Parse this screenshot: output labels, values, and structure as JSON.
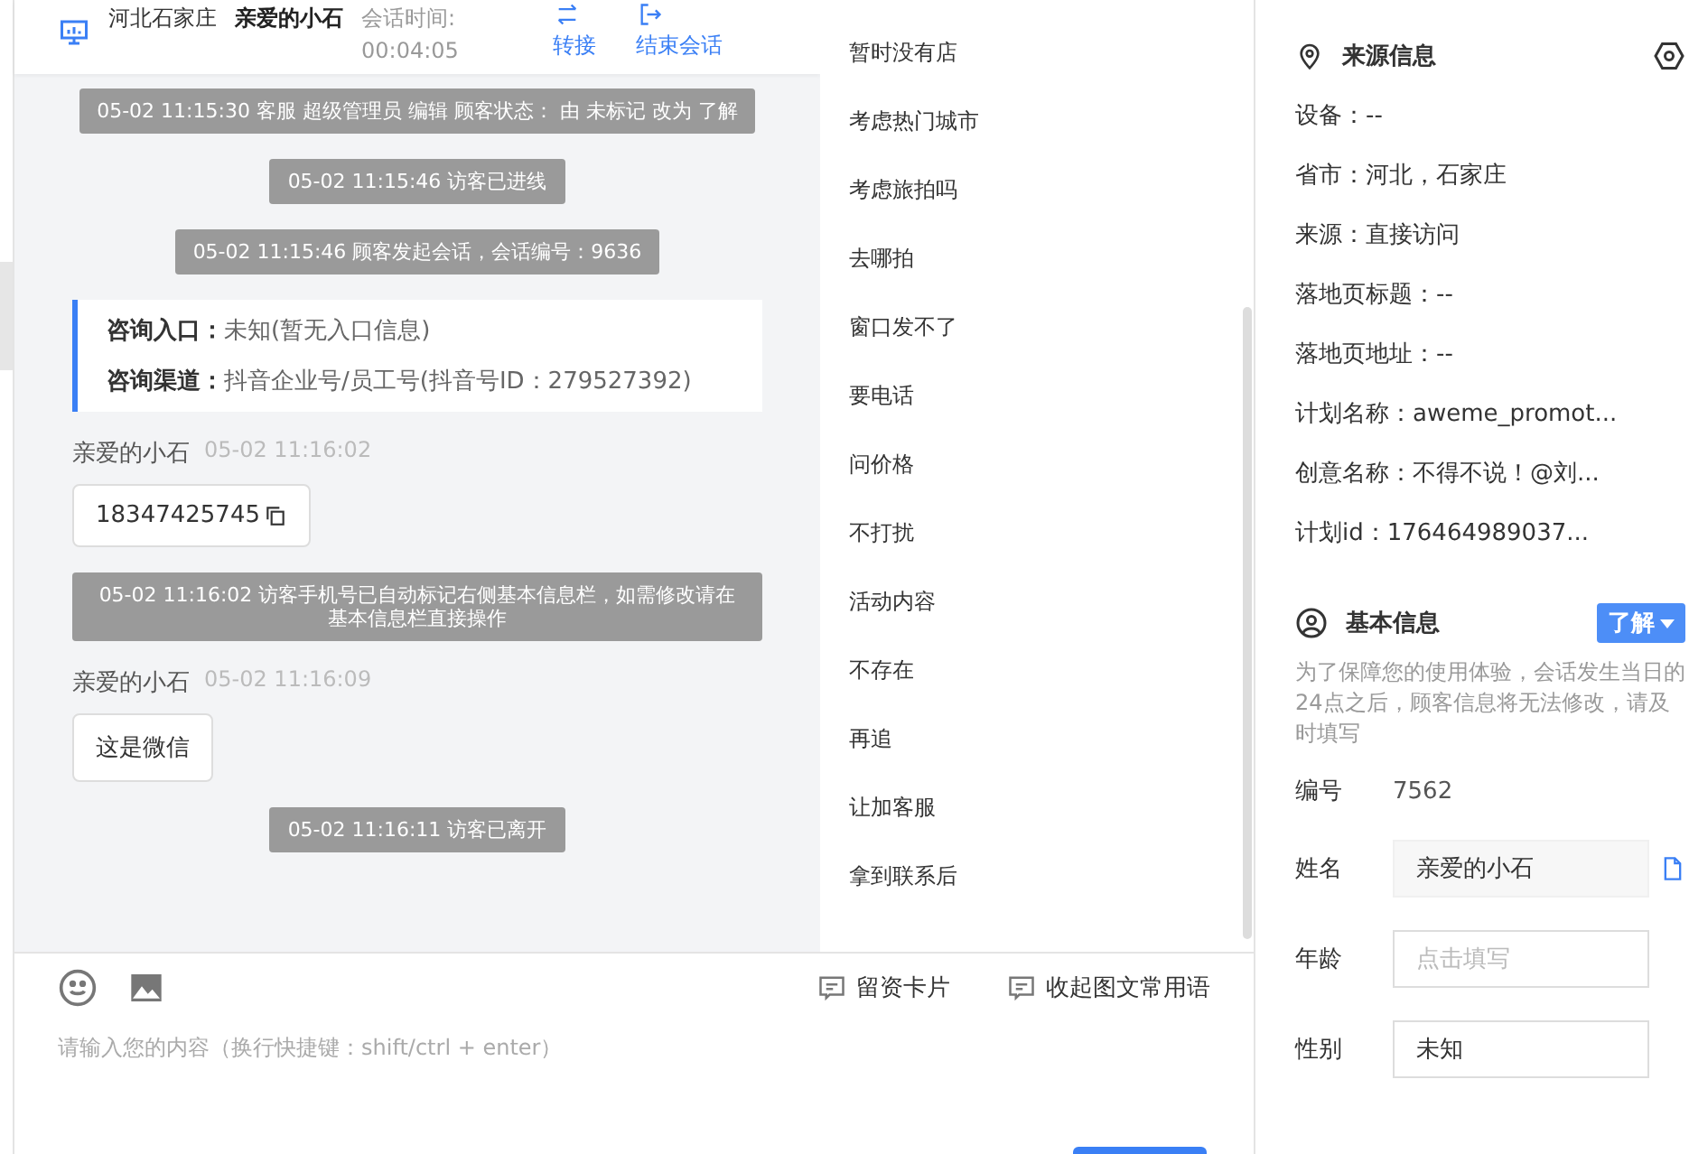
{
  "header": {
    "location": "河北石家庄",
    "visitor_name": "亲爱的小石",
    "session_label": "会话时间:",
    "session_time": "00:04:05",
    "actions": [
      {
        "kind": "transfer",
        "label": "转接"
      },
      {
        "kind": "end",
        "label": "结束会话"
      }
    ]
  },
  "messages": [
    {
      "kind": "system",
      "text": "05-02 11:15:30 客服 超级管理员 编辑 顾客状态： 由 未标记 改为 了解"
    },
    {
      "kind": "system",
      "text": "05-02 11:15:46 访客已进线"
    },
    {
      "kind": "system",
      "text": "05-02 11:15:46 顾客发起会话，会话编号：9636"
    },
    {
      "kind": "info",
      "lines": [
        {
          "label": "咨询入口：",
          "value": "未知(暂无入口信息)"
        },
        {
          "label": "咨询渠道：",
          "value": "抖音企业号/员工号(抖音号ID：279527392)"
        }
      ]
    },
    {
      "kind": "visitor",
      "name": "亲爱的小石",
      "time": "05-02 11:16:02",
      "text": "18347425745",
      "copyable": true
    },
    {
      "kind": "system",
      "text": "05-02 11:16:02 访客手机号已自动标记右侧基本信息栏，如需修改请在基本信息栏直接操作"
    },
    {
      "kind": "visitor",
      "name": "亲爱的小石",
      "time": "05-02 11:16:09",
      "text": "这是微信",
      "copyable": false
    },
    {
      "kind": "system",
      "text": "05-02 11:16:11 访客已离开"
    }
  ],
  "quick_replies": [
    "暂时没有店",
    "考虑热门城市",
    "考虑旅拍吗",
    "去哪拍",
    "窗口发不了",
    "要电话",
    "问价格",
    "不打扰",
    "活动内容",
    "不存在",
    "再追",
    "让加客服",
    "拿到联系后"
  ],
  "composer": {
    "tools": [
      {
        "kind": "emoji"
      },
      {
        "kind": "image"
      }
    ],
    "actions": [
      {
        "label": "留资卡片"
      },
      {
        "label": "收起图文常用语"
      }
    ],
    "placeholder": "请输入您的内容（换行快捷键：shift/ctrl + enter）"
  },
  "source_info": {
    "title": "来源信息",
    "fields": [
      "设备：--",
      "省市：河北，石家庄",
      "来源：直接访问",
      "落地页标题：--",
      "落地页地址：--",
      "计划名称：aweme_promot...",
      "创意名称：不得不说！@刘...",
      "计划id：176464989037..."
    ]
  },
  "basic_info": {
    "title": "基本信息",
    "status": "了解",
    "notice": "为了保障您的使用体验，会话发生当日的24点之后，顾客信息将无法修改，请及时填写",
    "rows": [
      {
        "kind": "text",
        "label": "编号",
        "value": "7562"
      },
      {
        "kind": "filled",
        "label": "姓名",
        "value": "亲爱的小石"
      },
      {
        "kind": "input",
        "label": "年龄",
        "placeholder": "点击填写"
      },
      {
        "kind": "input",
        "label": "性别",
        "value": "未知"
      }
    ]
  }
}
